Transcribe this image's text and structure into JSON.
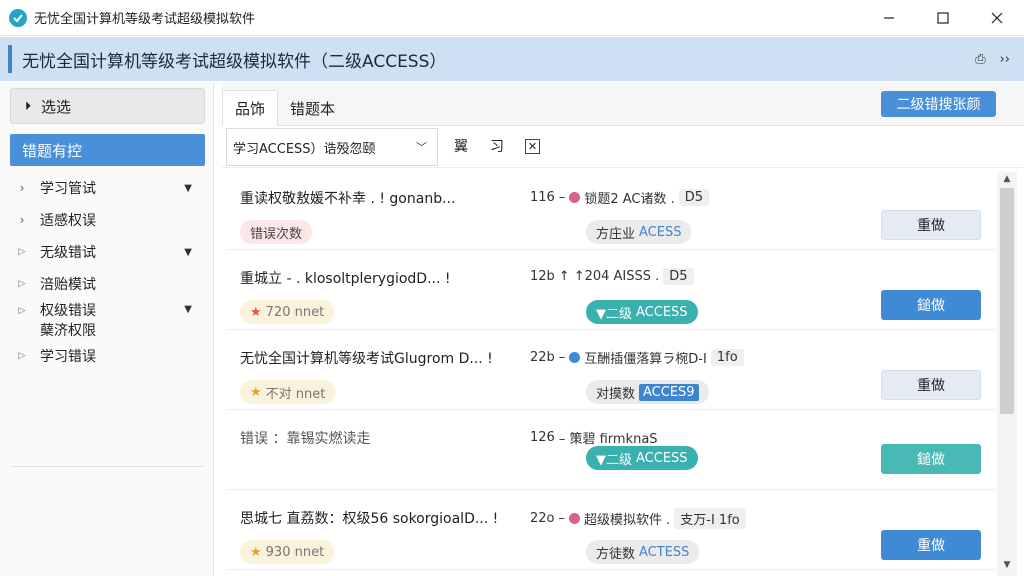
{
  "window": {
    "title": "无忧全国计算机等级考试超级模拟软件",
    "icon": "app-logo-icon",
    "accent": "#25a3c9"
  },
  "header": {
    "title": "无忧全国计算机等级考试超级模拟软件（二级ACCESS）",
    "tools": [
      "⎙",
      "››"
    ],
    "background": "#cfe0f3"
  },
  "sidebar": {
    "filter_label": "选选",
    "active_item": "错题有控",
    "items": [
      {
        "label": "学习管试",
        "chevron": "›",
        "dropdown": true
      },
      {
        "label": "适感权误",
        "chevron": "›",
        "dropdown": false
      },
      {
        "label": "无级错试",
        "chevron": "▷",
        "dropdown": true
      },
      {
        "label": "涪贻模试",
        "chevron": "▷",
        "dropdown": false
      },
      {
        "label": "权级错误",
        "label2": "蘖济权限",
        "chevron": "▷",
        "dropdown": true
      },
      {
        "label": "学习错误",
        "chevron": "▷",
        "dropdown": false
      }
    ]
  },
  "tabs": [
    {
      "label": "品饰"
    },
    {
      "label": "错题本"
    }
  ],
  "primary_button": "二级错搜张颜",
  "subbar": {
    "select_value": "学习ACCESS）诰殁忽颐",
    "tool1": "翼",
    "tool2": "习",
    "tool3": "☒"
  },
  "rows": [
    {
      "title": "重读权敬敖媛不补幸 . ! gonanb...",
      "num": "116",
      "sep": "–",
      "dot_color": "#d9618a",
      "meta_text": "锁题2 AC诸数 .",
      "code": "D5",
      "badge1": "错误次数",
      "badge1_style": "red",
      "badge2_pre": "方庄业",
      "badge2_acc": "ACESS",
      "badge2_style": "grey",
      "button": "重做",
      "button_style": "grey"
    },
    {
      "title": "重城立 - . klosoltplerygiodD... !",
      "num": "12b",
      "sep": "↑",
      "dot_color": "",
      "meta_text": "↑204 AISSS .",
      "code": "D5",
      "badge1": "720 nnet",
      "badge1_style": "yellow",
      "badge1_icon": "★",
      "badge2_pre": "▼二级",
      "badge2_acc": "ACCESS",
      "badge2_style": "teal",
      "button": "鎚做",
      "button_style": "blue"
    },
    {
      "title": "无忧全国计算机等级考试Glugrom D... !",
      "num": "22b",
      "sep": "–",
      "dot_color": "#3f8ad6",
      "meta_text": "互酬插僵落算ラ椀D-I",
      "code": "1fo",
      "badge1": "不对 nnet",
      "badge1_style": "yellow",
      "badge1_icon": "★",
      "badge2_pre": "对摸数",
      "badge2_acc": "ACCES9",
      "badge2_style": "grey-box",
      "button": "重做",
      "button_style": "grey"
    },
    {
      "title": "错误 ：靠锡实燃读走",
      "num": "126",
      "sep": "–",
      "dot_color": "",
      "meta_text": "–  策碧 firmknaS",
      "code": "",
      "badge1": "",
      "badge1_style": "",
      "badge2_pre": "▼二级",
      "badge2_acc": "ACCESS",
      "badge2_style": "teal",
      "button": "鎚做",
      "button_style": "teal"
    },
    {
      "title": "思城七 直荔数：权级56 sokorgioalD... !",
      "num": "22o",
      "sep": "–",
      "dot_color": "#d9618a",
      "meta_text": "超级模拟软件 .",
      "code": "支万-I  1fo",
      "badge1": "930 nnet",
      "badge1_style": "yellow",
      "badge1_icon": "★",
      "badge2_pre": "方徒数",
      "badge2_acc": "ACTESS",
      "badge2_style": "grey",
      "button": "重做",
      "button_style": "blue"
    }
  ],
  "colors": {
    "primary": "#4a90d9",
    "teal": "#48b9b5",
    "header": "#cfe0f3"
  }
}
